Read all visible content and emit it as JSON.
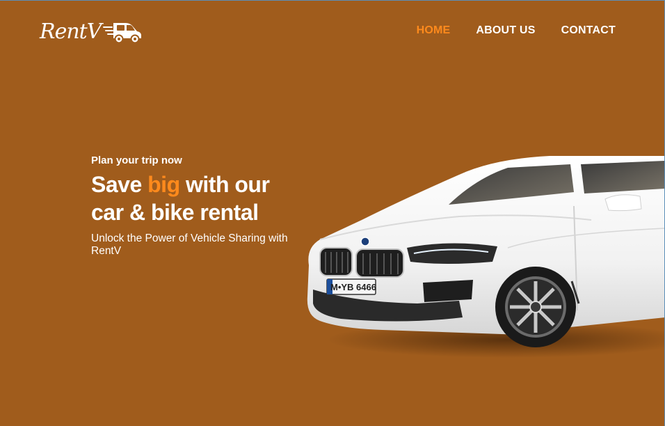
{
  "header": {
    "logo_text": "RentV",
    "logo_icon": "van-icon",
    "nav": [
      {
        "label": "HOME",
        "active": true
      },
      {
        "label": "ABOUT US",
        "active": false
      },
      {
        "label": "CONTACT",
        "active": false
      }
    ]
  },
  "hero": {
    "eyebrow": "Plan your trip now",
    "headline_pre": "Save ",
    "headline_accent": "big",
    "headline_post": " with our car & bike rental",
    "subtext": "Unlock the Power of Vehicle Sharing with RentV",
    "car_plate": "M•YB 6466"
  },
  "colors": {
    "background": "#a05c1c",
    "accent": "#ff8a1c",
    "text": "#ffffff"
  }
}
